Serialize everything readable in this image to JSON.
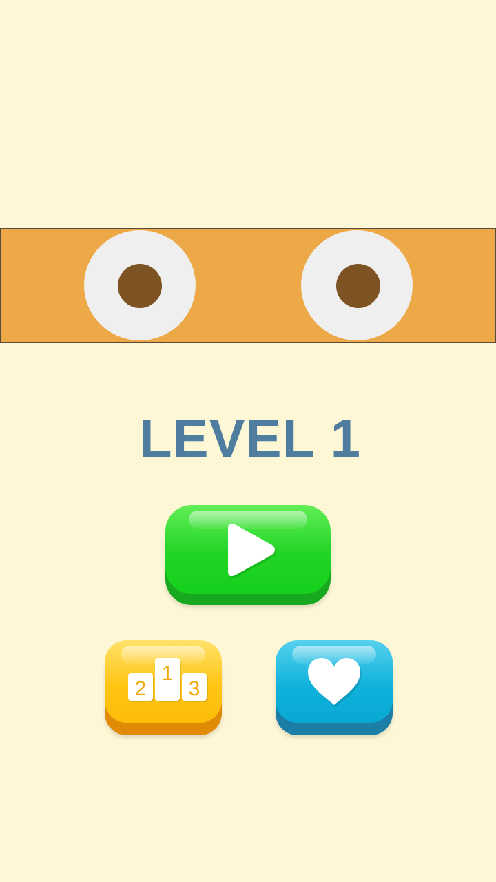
{
  "level": {
    "title": "LEVEL 1"
  },
  "buttons": {
    "play": {
      "icon": "play-icon"
    },
    "leaderboard": {
      "icon": "podium-icon",
      "ranks": [
        "2",
        "1",
        "3"
      ]
    },
    "favorite": {
      "icon": "heart-icon"
    }
  },
  "colors": {
    "background": "#fdf7d6",
    "band": "#eda947",
    "eye_white": "#efefef",
    "pupil": "#7d5324",
    "title": "#4f7d9f",
    "play_green": "#21d425",
    "leaderboard_yellow": "#ffc514",
    "favorite_blue": "#10b2dc"
  }
}
